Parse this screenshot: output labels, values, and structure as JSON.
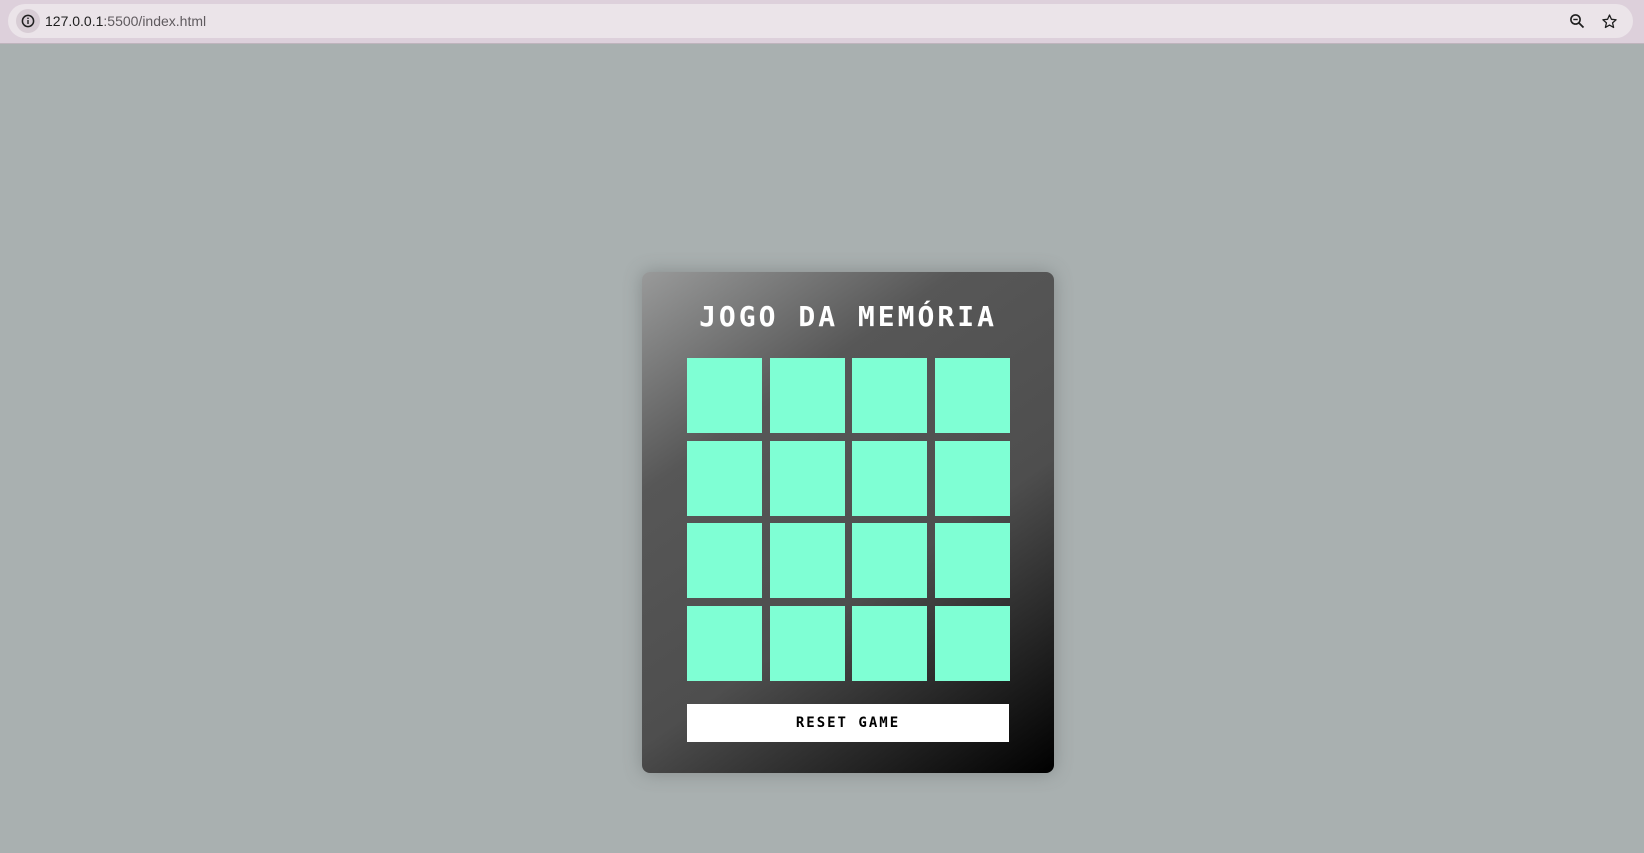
{
  "browser": {
    "url_host": "127.0.0.1",
    "url_path": ":5500/index.html",
    "icons": {
      "site_info": "info-icon",
      "zoom": "zoom-out-icon",
      "bookmark": "star-icon"
    }
  },
  "game": {
    "title": "JOGO DA MEMÓRIA",
    "tile_color": "#7fffd4",
    "tiles": [
      {
        "state": "hidden"
      },
      {
        "state": "hidden"
      },
      {
        "state": "hidden"
      },
      {
        "state": "hidden"
      },
      {
        "state": "hidden"
      },
      {
        "state": "hidden"
      },
      {
        "state": "hidden"
      },
      {
        "state": "hidden"
      },
      {
        "state": "hidden"
      },
      {
        "state": "hidden"
      },
      {
        "state": "hidden"
      },
      {
        "state": "hidden"
      },
      {
        "state": "hidden"
      },
      {
        "state": "hidden"
      },
      {
        "state": "hidden"
      },
      {
        "state": "hidden"
      }
    ],
    "reset_label": "RESET GAME"
  },
  "colors": {
    "page_background": "#a9b0b0",
    "tile": "#7fffd4",
    "button_background": "#ffffff"
  }
}
